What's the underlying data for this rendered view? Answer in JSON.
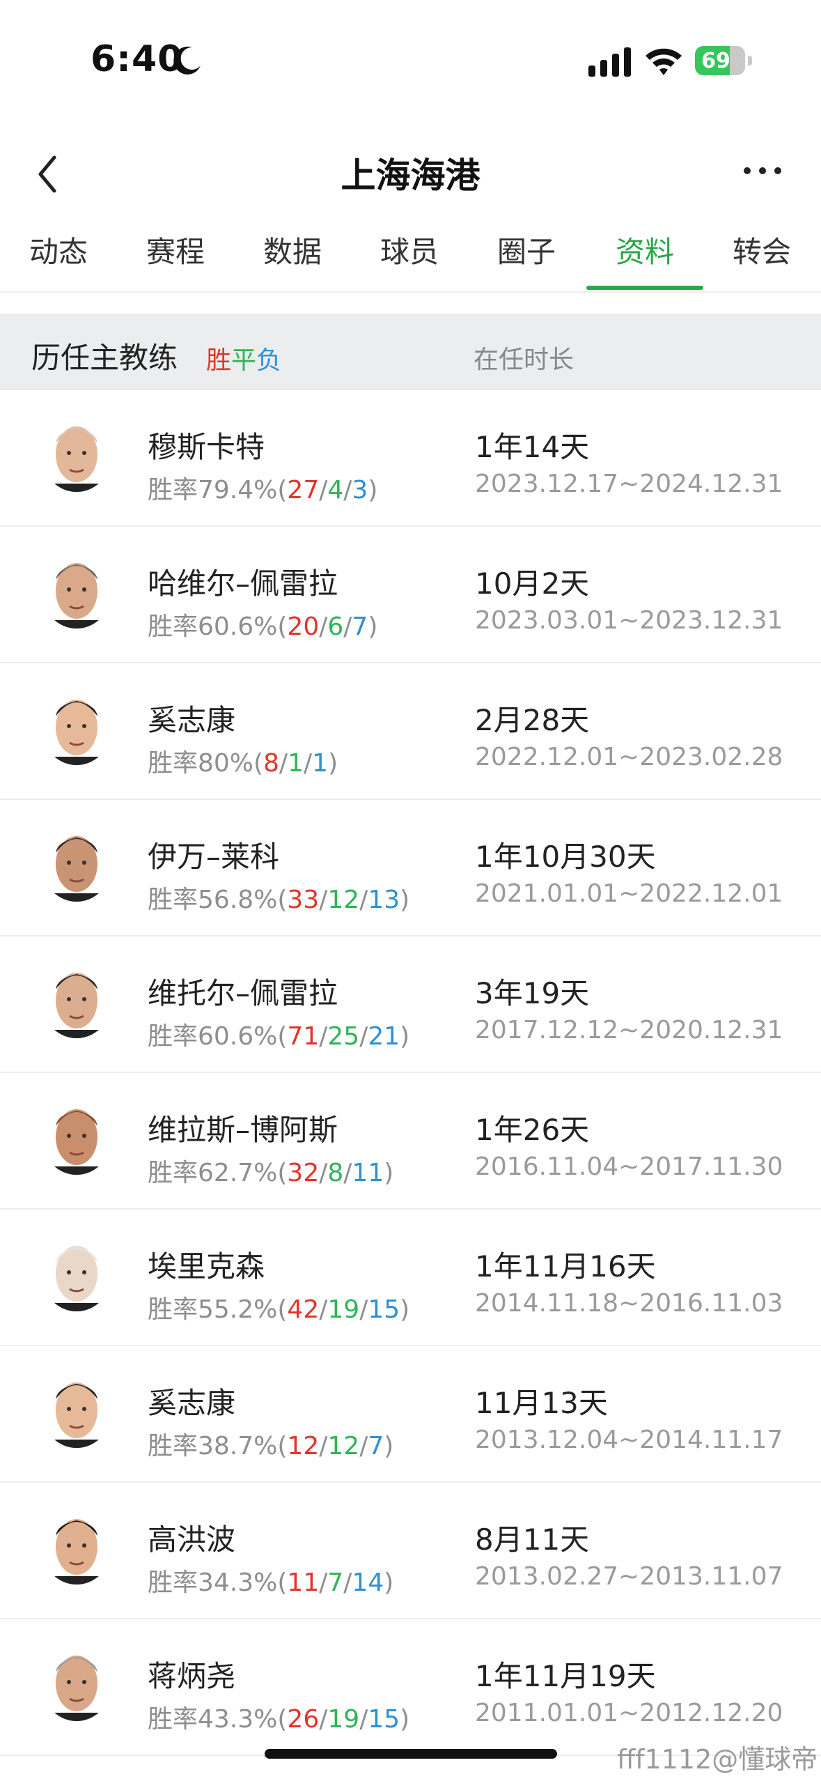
{
  "status_bar": {
    "time": "6:40",
    "battery": "69",
    "battery_level": 0.69
  },
  "header": {
    "title": "上海海港",
    "back_icon": "chevron-left-icon",
    "more_icon": "ellipsis-icon"
  },
  "tabs": [
    {
      "label": "动态"
    },
    {
      "label": "赛程"
    },
    {
      "label": "数据"
    },
    {
      "label": "球员"
    },
    {
      "label": "圈子"
    },
    {
      "label": "资料",
      "active": true
    },
    {
      "label": "转会"
    }
  ],
  "section": {
    "title": "历任主教练",
    "legend_win": "胜",
    "legend_draw": "平",
    "legend_loss": "负",
    "col_tenure": "在任时长"
  },
  "colors": {
    "accent": "#28a745",
    "win": "#e0352b",
    "draw": "#2fb457",
    "loss": "#2d90d6"
  },
  "coaches": [
    {
      "name": "穆斯卡特",
      "rate": "胜率79.4%",
      "win": "27",
      "draw": "4",
      "loss": "3",
      "tenure": "1年14天",
      "dates": "2023.12.17~2024.12.31"
    },
    {
      "name": "哈维尔–佩雷拉",
      "rate": "胜率60.6%",
      "win": "20",
      "draw": "6",
      "loss": "7",
      "tenure": "10月2天",
      "dates": "2023.03.01~2023.12.31"
    },
    {
      "name": "奚志康",
      "rate": "胜率80%",
      "win": "8",
      "draw": "1",
      "loss": "1",
      "tenure": "2月28天",
      "dates": "2022.12.01~2023.02.28"
    },
    {
      "name": "伊万–莱科",
      "rate": "胜率56.8%",
      "win": "33",
      "draw": "12",
      "loss": "13",
      "tenure": "1年10月30天",
      "dates": "2021.01.01~2022.12.01"
    },
    {
      "name": "维托尔–佩雷拉",
      "rate": "胜率60.6%",
      "win": "71",
      "draw": "25",
      "loss": "21",
      "tenure": "3年19天",
      "dates": "2017.12.12~2020.12.31"
    },
    {
      "name": "维拉斯–博阿斯",
      "rate": "胜率62.7%",
      "win": "32",
      "draw": "8",
      "loss": "11",
      "tenure": "1年26天",
      "dates": "2016.11.04~2017.11.30"
    },
    {
      "name": "埃里克森",
      "rate": "胜率55.2%",
      "win": "42",
      "draw": "19",
      "loss": "15",
      "tenure": "1年11月16天",
      "dates": "2014.11.18~2016.11.03"
    },
    {
      "name": "奚志康",
      "rate": "胜率38.7%",
      "win": "12",
      "draw": "12",
      "loss": "7",
      "tenure": "11月13天",
      "dates": "2013.12.04~2014.11.17"
    },
    {
      "name": "高洪波",
      "rate": "胜率34.3%",
      "win": "11",
      "draw": "7",
      "loss": "14",
      "tenure": "8月11天",
      "dates": "2013.02.27~2013.11.07"
    },
    {
      "name": "蒋炳尧",
      "rate": "胜率43.3%",
      "win": "26",
      "draw": "19",
      "loss": "15",
      "tenure": "1年11月19天",
      "dates": "2011.01.01~2012.12.20"
    }
  ],
  "watermark": "fff1112@懂球帝"
}
